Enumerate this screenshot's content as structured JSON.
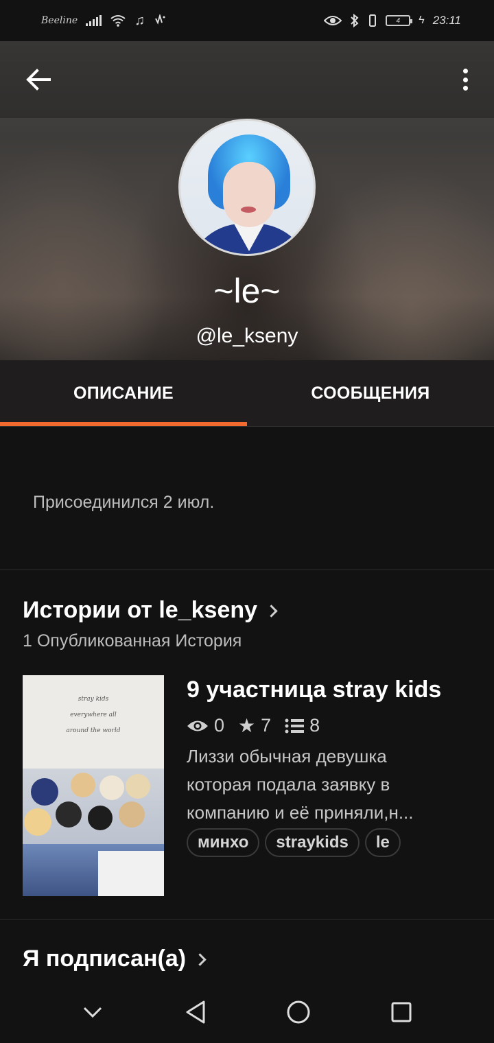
{
  "status_bar": {
    "carrier": "Beeline",
    "time": "23:11",
    "battery": "4"
  },
  "profile": {
    "display_name": "~le~",
    "username": "@le_kseny"
  },
  "tabs": [
    {
      "label": "ОПИСАНИЕ",
      "active": true
    },
    {
      "label": "СООБЩЕНИЯ",
      "active": false
    }
  ],
  "about": {
    "joined": "Присоединился 2 июл."
  },
  "stories_section": {
    "title": "Истории от le_kseny",
    "subtitle": "1 Опубликованная История"
  },
  "story": {
    "cover_text": [
      "stray kids",
      "everywhere all",
      "around the world"
    ],
    "title": "9 участница stray kids",
    "views": "0",
    "votes": "7",
    "parts": "8",
    "description": "Лиззи обычная девушка которая подала заявку в компанию и её приняли,н...",
    "tags": [
      "минхо",
      "straykids",
      "le"
    ]
  },
  "following_section": {
    "title": "Я подписан(а)"
  },
  "colors": {
    "accent": "#f26a2e",
    "background": "#121212",
    "tab_bar": "#1f1d1e"
  }
}
